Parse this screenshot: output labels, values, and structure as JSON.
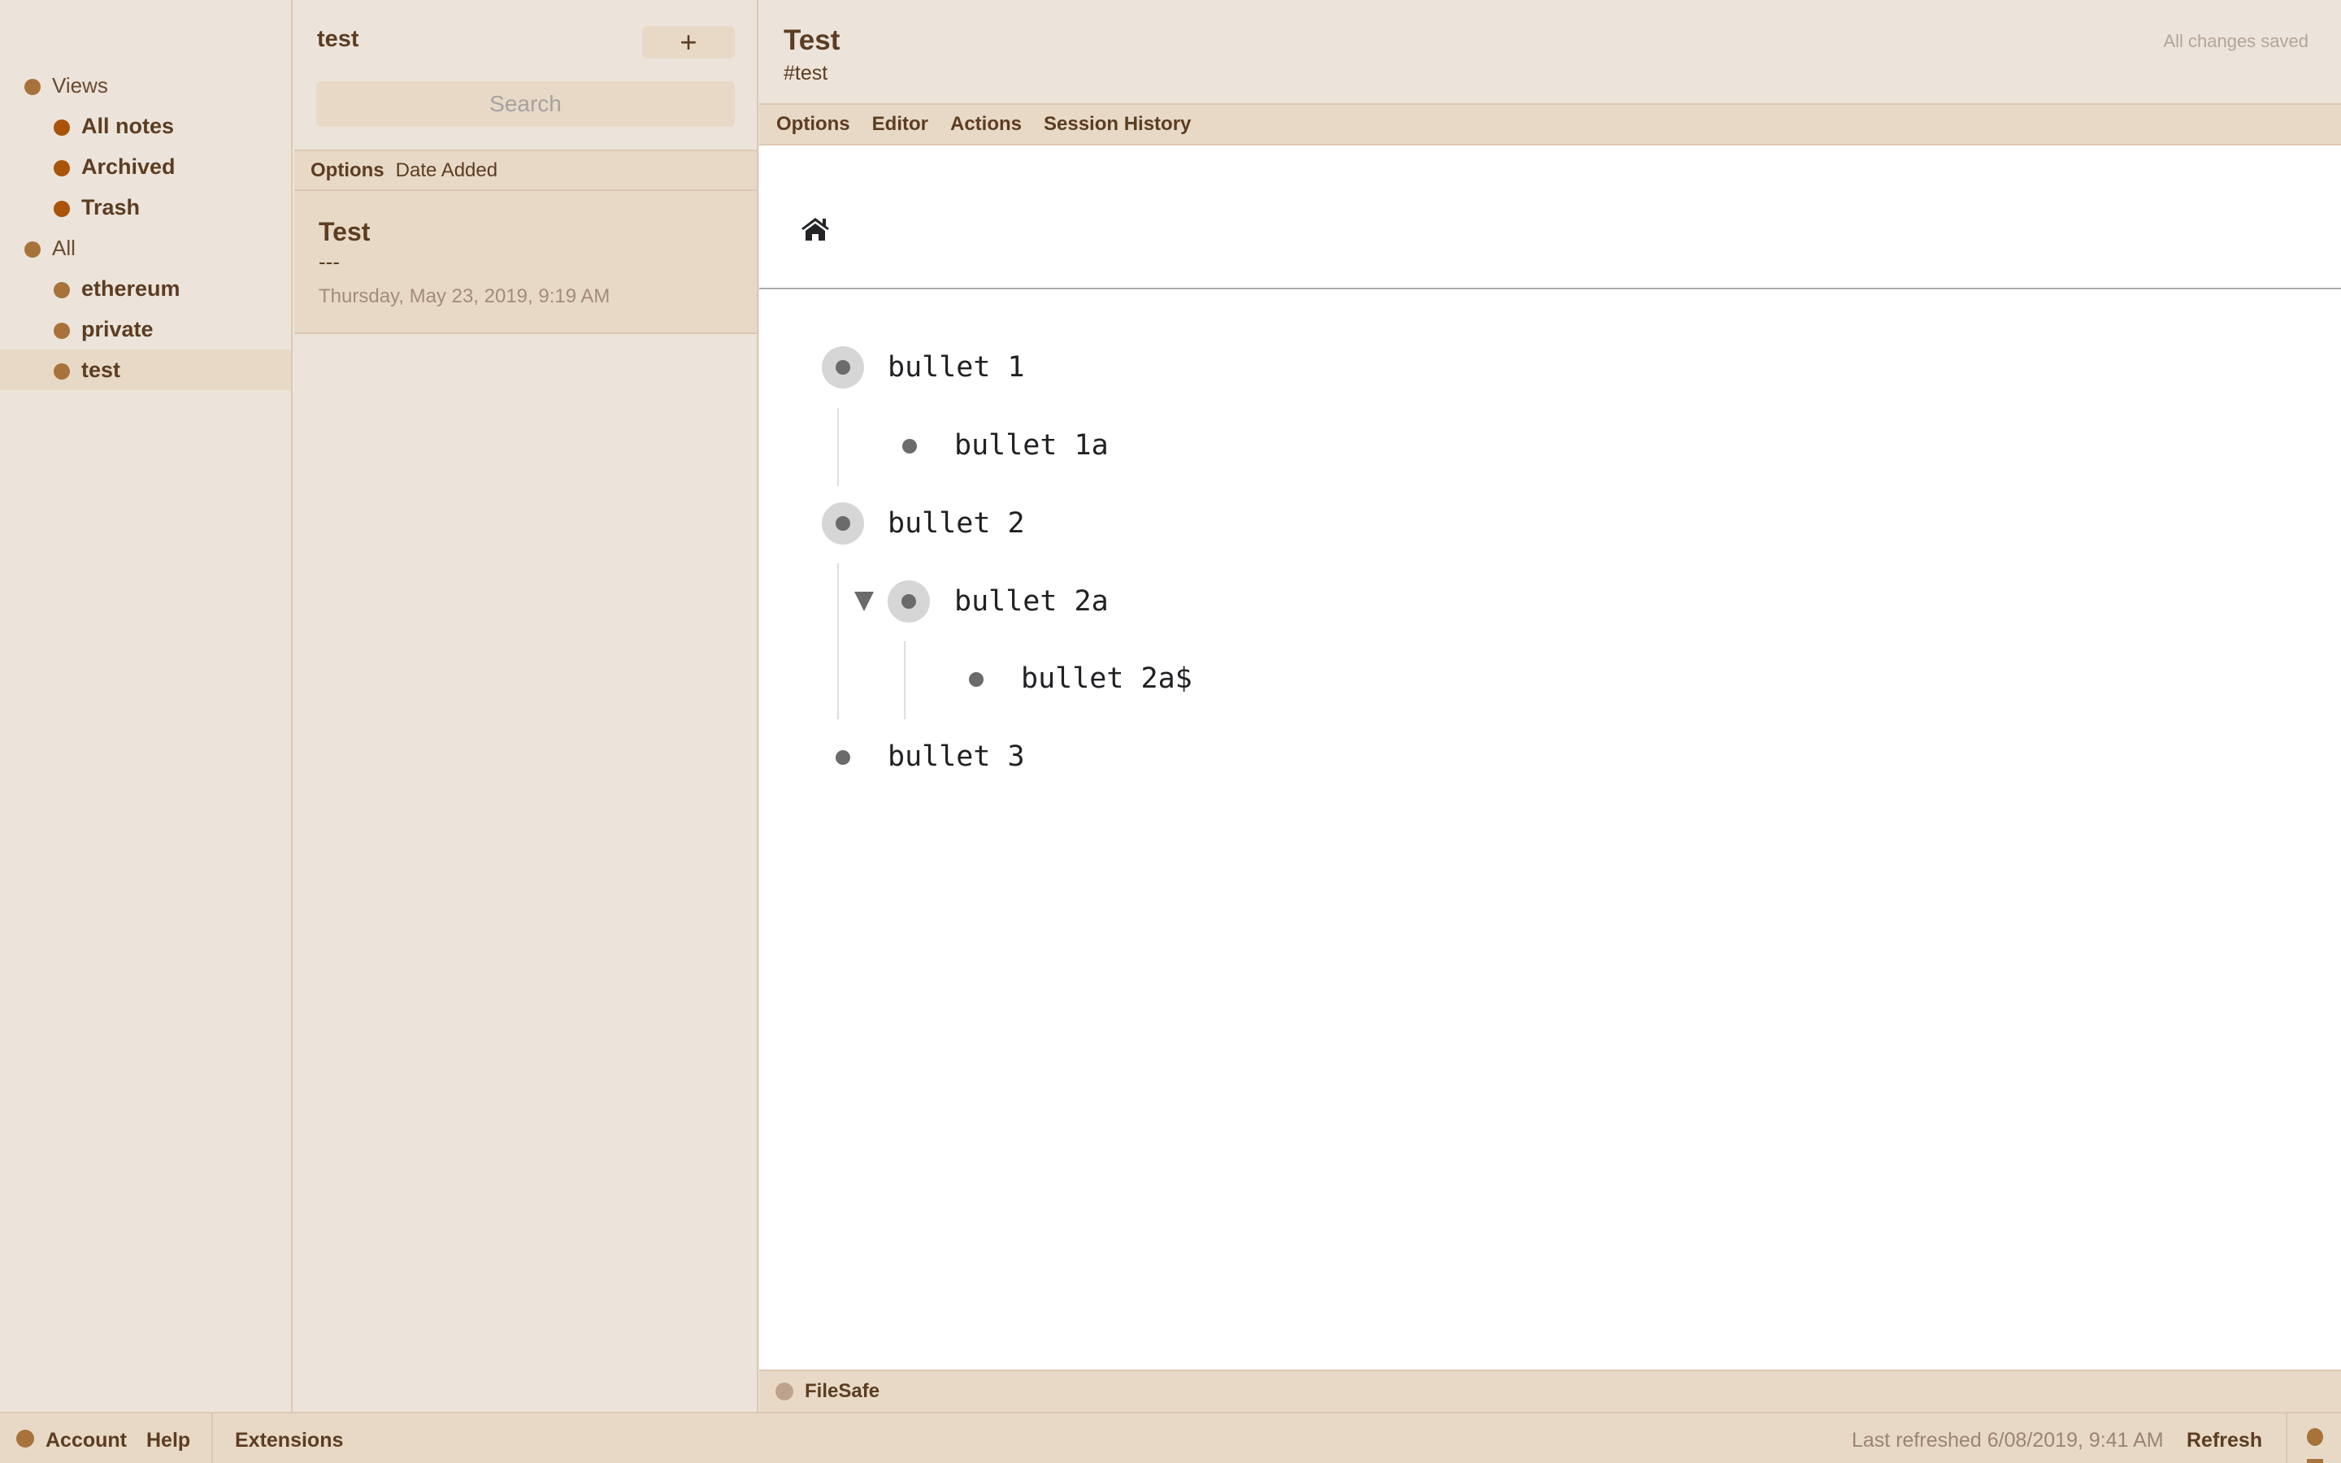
{
  "sidebar": {
    "items": [
      {
        "label": "Views",
        "level": 0,
        "dot_color": "#a7733b",
        "selected": false
      },
      {
        "label": "All notes",
        "level": 1,
        "dot_color": "#a9540a",
        "selected": false
      },
      {
        "label": "Archived",
        "level": 1,
        "dot_color": "#a9540a",
        "selected": false
      },
      {
        "label": "Trash",
        "level": 1,
        "dot_color": "#a9540a",
        "selected": false
      },
      {
        "label": "All",
        "level": 0,
        "dot_color": "#a7733b",
        "selected": false
      },
      {
        "label": "ethereum",
        "level": 1,
        "dot_color": "#a7733b",
        "selected": false
      },
      {
        "label": "private",
        "level": 1,
        "dot_color": "#a7733b",
        "selected": false
      },
      {
        "label": "test",
        "level": 1,
        "dot_color": "#a7733b",
        "selected": true
      }
    ]
  },
  "notes_list": {
    "title": "test",
    "new_note_label": "+",
    "search_placeholder": "Search",
    "options_label": "Options",
    "sort_label": "Date Added",
    "notes": [
      {
        "title": "Test",
        "preview": "---",
        "date": "Thursday, May 23, 2019, 9:19 AM"
      }
    ]
  },
  "editor": {
    "title": "Test",
    "tags": "#test",
    "save_status": "All changes saved",
    "menu": [
      "Options",
      "Editor",
      "Actions",
      "Session History"
    ],
    "home_icon": "home-icon",
    "bullets": [
      {
        "text": "bullet 1",
        "depth": 0,
        "has_children": true,
        "collapse_toggle": false
      },
      {
        "text": "bullet 1a",
        "depth": 1,
        "has_children": false,
        "collapse_toggle": false
      },
      {
        "text": "bullet 2",
        "depth": 0,
        "has_children": true,
        "collapse_toggle": false
      },
      {
        "text": "bullet 2a",
        "depth": 1,
        "has_children": true,
        "collapse_toggle": true
      },
      {
        "text": "bullet 2a$",
        "depth": 2,
        "has_children": false,
        "collapse_toggle": false
      },
      {
        "text": "bullet 3",
        "depth": 0,
        "has_children": false,
        "collapse_toggle": false
      }
    ],
    "filesafe_label": "FileSafe"
  },
  "footer": {
    "account_label": "Account",
    "help_label": "Help",
    "extensions_label": "Extensions",
    "last_refreshed": "Last refreshed 6/08/2019, 9:41 AM",
    "refresh_label": "Refresh"
  },
  "colors": {
    "background": "#ece4da",
    "panel_dark": "#e8d9c7",
    "border": "#dcc8b2",
    "text": "#5c3d22",
    "tag_dot": "#a7733b",
    "view_dot": "#a9540a"
  }
}
